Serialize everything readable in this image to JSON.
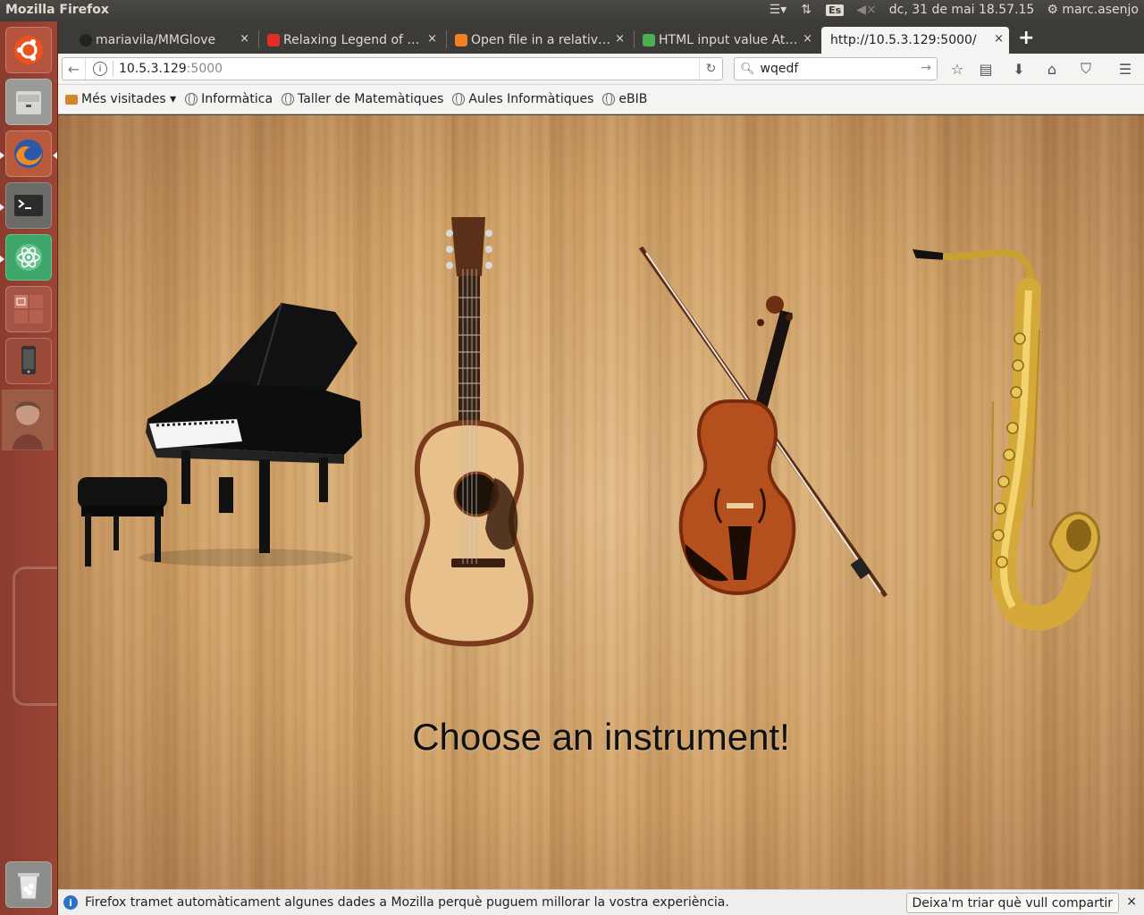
{
  "system_panel": {
    "app_title": "Mozilla Firefox",
    "keyboard_layout": "Es",
    "datetime": "dc, 31 de mai 18.57.15",
    "user": "marc.asenjo"
  },
  "tabs": [
    {
      "label": "mariavila/MMGlove",
      "close": "×"
    },
    {
      "label": "Relaxing Legend of …",
      "close": "×"
    },
    {
      "label": "Open file in a relativ…",
      "close": "×"
    },
    {
      "label": "HTML input value At…",
      "close": "×"
    },
    {
      "label": "http://10.5.3.129:5000/",
      "close": "×"
    }
  ],
  "new_tab_label": "+",
  "navbar": {
    "url_host": "10.5.3.129",
    "url_port": ":5000",
    "search_query": "wqedf"
  },
  "bookmarks": [
    {
      "label": "Més visitades ▾",
      "icon": "folder-icon"
    },
    {
      "label": "Informàtica",
      "icon": "globe-icon"
    },
    {
      "label": "Taller de Matemàtiques",
      "icon": "globe-icon"
    },
    {
      "label": "Aules Informàtiques",
      "icon": "globe-icon"
    },
    {
      "label": "eBIB",
      "icon": "globe-icon"
    }
  ],
  "page": {
    "headline": "Choose an instrument!",
    "instruments": [
      "piano",
      "guitar",
      "violin",
      "saxophone"
    ]
  },
  "notification": {
    "message": "Firefox tramet automàticament algunes dades a Mozilla perquè puguem millorar la vostra experiència.",
    "button": "Deixa'm triar què vull compartir",
    "close": "×"
  },
  "launcher": [
    "ubuntu-dash",
    "files",
    "firefox",
    "terminal",
    "atom",
    "workspaces",
    "phone",
    "avatar",
    "trash"
  ]
}
